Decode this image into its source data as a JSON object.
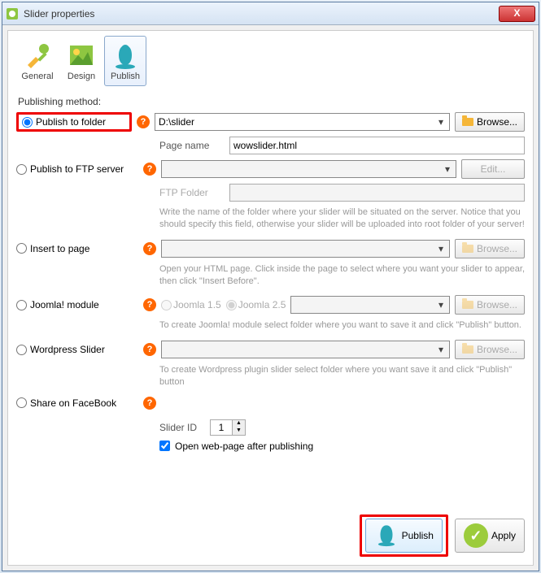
{
  "window": {
    "title": "Slider properties"
  },
  "tabs": {
    "general": "General",
    "design": "Design",
    "publish": "Publish"
  },
  "section": {
    "method_label": "Publishing method:"
  },
  "methods": {
    "folder": {
      "label": "Publish to folder",
      "path": "D:\\slider",
      "browse": "Browse...",
      "page_name_label": "Page name",
      "page_name_value": "wowslider.html"
    },
    "ftp": {
      "label": "Publish to FTP server",
      "edit": "Edit...",
      "ftp_folder_label": "FTP Folder",
      "desc": "Write the name of the folder where your slider will be situated on the server. Notice that you should specify this field, otherwise your slider will be uploaded into root folder of your server!"
    },
    "insert": {
      "label": "Insert to page",
      "browse": "Browse...",
      "desc": "Open your HTML page. Click inside the page to select where you want your slider to appear, then click \"Insert Before\"."
    },
    "joomla": {
      "label": "Joomla! module",
      "opt15": "Joomla 1.5",
      "opt25": "Joomla 2.5",
      "browse": "Browse...",
      "desc": "To create Joomla! module select folder where you want to save it and click \"Publish\" button."
    },
    "wordpress": {
      "label": "Wordpress Slider",
      "browse": "Browse...",
      "desc": "To create Wordpress plugin slider select folder where you want save it and click \"Publish\" button"
    },
    "facebook": {
      "label": "Share on FaceBook"
    }
  },
  "slider_id": {
    "label": "Slider ID",
    "value": "1"
  },
  "open_after": {
    "label": "Open web-page after publishing"
  },
  "buttons": {
    "publish": "Publish",
    "apply": "Apply"
  }
}
